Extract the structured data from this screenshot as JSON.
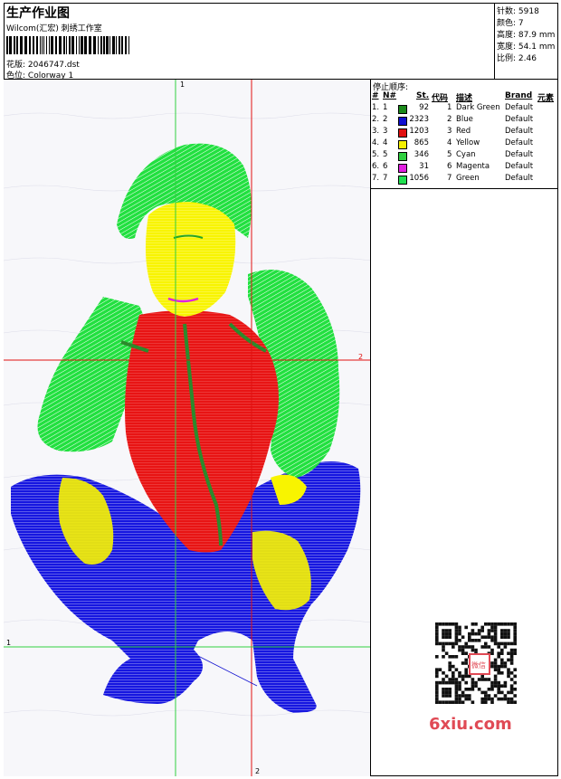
{
  "header": {
    "title": "生产作业图",
    "company": "Wilcom(汇宏) 刺绣工作室",
    "design_file_label": "花版:",
    "design_file": "2046747.dst",
    "colorway_label": "色位:",
    "colorway": "Colorway 1"
  },
  "specs": [
    {
      "label": "针数:",
      "value": "5918"
    },
    {
      "label": "颜色:",
      "value": "7"
    },
    {
      "label": "高度:",
      "value": "87.9 mm"
    },
    {
      "label": "宽度:",
      "value": "54.1 mm"
    },
    {
      "label": "比例:",
      "value": "2.46"
    }
  ],
  "stop_sequence": {
    "title": "停止顺序:",
    "columns": [
      "#",
      "N#",
      "St.",
      "代码",
      "描述",
      "Brand",
      "元素"
    ],
    "rows": [
      {
        "num": "1.",
        "n": "1",
        "color": "#1b8a1b",
        "st": "92",
        "code": "1",
        "desc": "Dark Green",
        "brand": "Default"
      },
      {
        "num": "2.",
        "n": "2",
        "color": "#1010d0",
        "st": "2323",
        "code": "2",
        "desc": "Blue",
        "brand": "Default"
      },
      {
        "num": "3.",
        "n": "3",
        "color": "#e01010",
        "st": "1203",
        "code": "3",
        "desc": "Red",
        "brand": "Default"
      },
      {
        "num": "4.",
        "n": "4",
        "color": "#f5f000",
        "st": "865",
        "code": "4",
        "desc": "Yellow",
        "brand": "Default"
      },
      {
        "num": "5.",
        "n": "5",
        "color": "#30d040",
        "st": "346",
        "code": "5",
        "desc": "Cyan",
        "brand": "Default"
      },
      {
        "num": "6.",
        "n": "6",
        "color": "#e020e0",
        "st": "31",
        "code": "6",
        "desc": "Magenta",
        "brand": "Default"
      },
      {
        "num": "7.",
        "n": "7",
        "color": "#20e050",
        "st": "1056",
        "code": "7",
        "desc": "Green",
        "brand": "Default"
      }
    ]
  },
  "guides": {
    "v1_label": "1",
    "v2_label": "2",
    "h1_label": "1",
    "h2_label": "2"
  },
  "watermark": "6xiu.com",
  "qr_center_text": "微信"
}
